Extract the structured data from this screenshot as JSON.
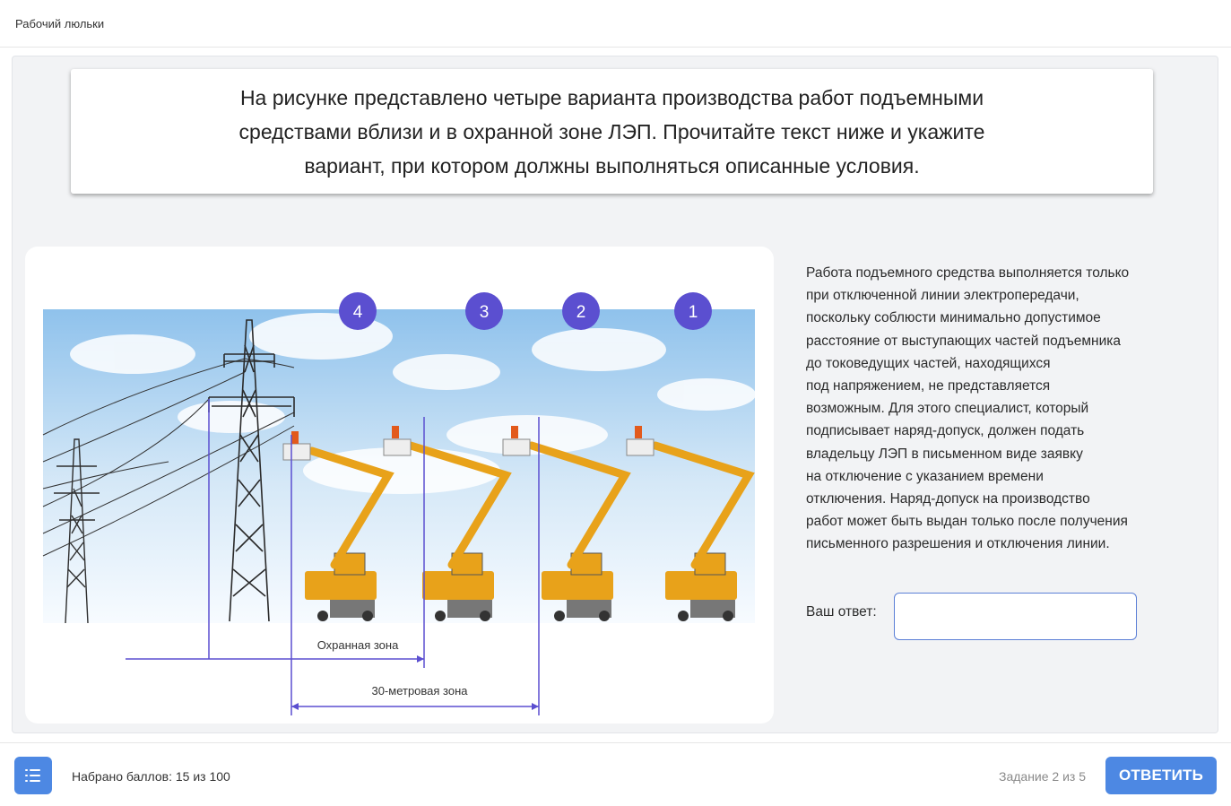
{
  "header": {
    "title": "Рабочий люльки"
  },
  "question": {
    "text": "На рисунке представлено четыре варианта производства работ подъемными средствами вблизи и в охранной зоне ЛЭП. Прочитайте текст ниже и укажите вариант, при котором должны выполняться описанные условия."
  },
  "figure": {
    "markers": [
      "4",
      "3",
      "2",
      "1"
    ],
    "zone_guard_label": "Охранная зона",
    "zone_30m_label": "30-метровая зона",
    "colors": {
      "marker": "#5b4fd0",
      "line": "#5b4fd0",
      "crane": "#e8a21a",
      "sky": "#9dc9ee"
    }
  },
  "description": {
    "text": "Работа подъемного средства выполняется только\nпри отключенной линии электропередачи,\nпоскольку соблюсти минимально допустимое\nрасстояние от выступающих частей подъемника\nдо токоведущих частей, находящихся\nпод напряжением, не представляется\nвозможным. Для этого специалист, который\nподписывает наряд-допуск, должен подать\nвладельцу ЛЭП в письменном виде заявку\nна отключение с указанием времени\nотключения. Наряд-допуск на производство\nработ может быть выдан только после получения\nписьменного разрешения и отключения линии."
  },
  "answer": {
    "label": "Ваш ответ:",
    "value": "",
    "placeholder": ""
  },
  "footer": {
    "menu_icon": "list-icon",
    "score_text": "Набрано баллов: 15 из 100",
    "progress_text": "Задание 2 из 5",
    "submit_label": "ОТВЕТИТЬ"
  }
}
